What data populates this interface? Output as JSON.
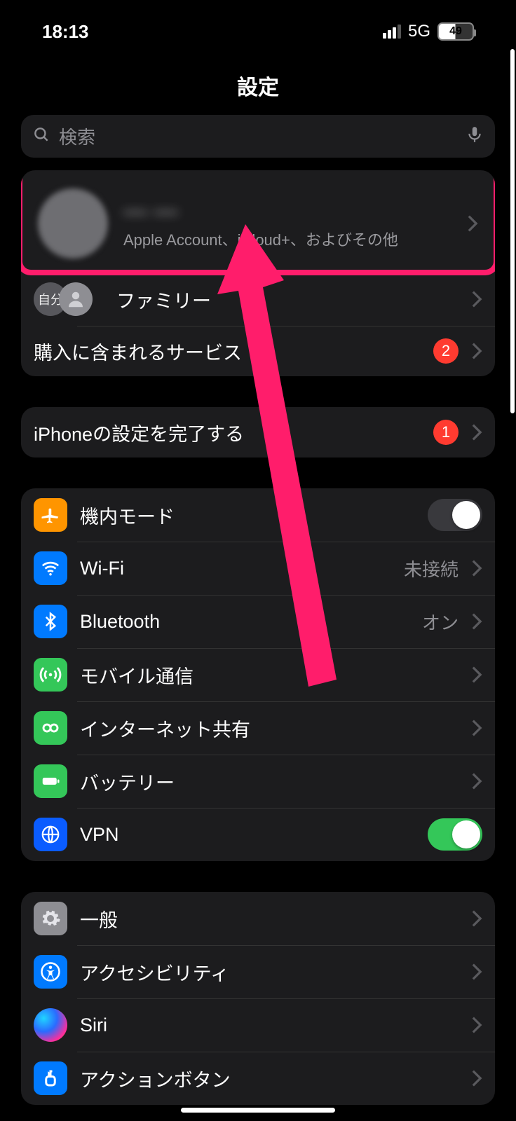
{
  "status": {
    "time": "18:13",
    "network": "5G",
    "battery": "49"
  },
  "title": "設定",
  "search": {
    "placeholder": "検索"
  },
  "account": {
    "name": "— —",
    "subtitle": "Apple Account、iCloud+、およびその他",
    "family_badge": "自分",
    "family_label": "ファミリー",
    "purchases_label": "購入に含まれるサービス",
    "purchases_badge": "2"
  },
  "finish_setup": {
    "label": "iPhoneの設定を完了する",
    "badge": "1"
  },
  "group_connectivity": {
    "airplane": {
      "label": "機内モード"
    },
    "wifi": {
      "label": "Wi-Fi",
      "value": "未接続"
    },
    "bluetooth": {
      "label": "Bluetooth",
      "value": "オン"
    },
    "cellular": {
      "label": "モバイル通信"
    },
    "hotspot": {
      "label": "インターネット共有"
    },
    "battery": {
      "label": "バッテリー"
    },
    "vpn": {
      "label": "VPN"
    }
  },
  "group_general": {
    "general": {
      "label": "一般"
    },
    "accessibility": {
      "label": "アクセシビリティ"
    },
    "siri": {
      "label": "Siri"
    },
    "action_button": {
      "label": "アクションボタン"
    }
  }
}
